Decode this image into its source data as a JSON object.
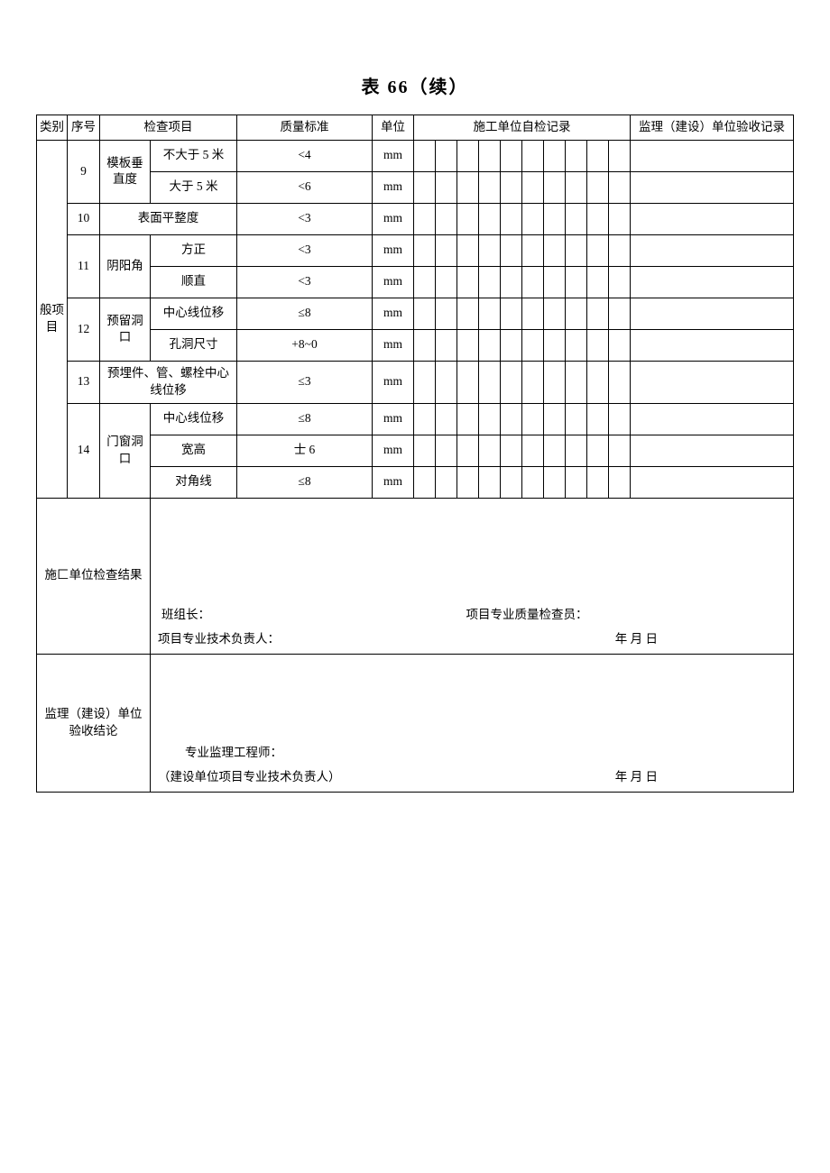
{
  "title": "表 66（续）",
  "headers": {
    "category": "类别",
    "seq": "序号",
    "check_item": "检查项目",
    "quality_std": "质量标准",
    "unit": "单位",
    "self_check": "施工单位自检记录",
    "supervise": "监理（建设）单位验收记录"
  },
  "category_label": "般项目",
  "rows": [
    {
      "seq": "9",
      "group": "模板垂直度",
      "sub": "不大于 5 米",
      "std": "<4",
      "unit": "mm"
    },
    {
      "seq": "",
      "group": "",
      "sub": "大于 5 米",
      "std": "<6",
      "unit": "mm"
    },
    {
      "seq": "10",
      "group": "表面平整度",
      "sub": "",
      "std": "<3",
      "unit": "mm"
    },
    {
      "seq": "11",
      "group": "阴阳角",
      "sub": "方正",
      "std": "<3",
      "unit": "mm"
    },
    {
      "seq": "",
      "group": "",
      "sub": "顺直",
      "std": "<3",
      "unit": "mm"
    },
    {
      "seq": "12",
      "group": "预留洞口",
      "sub": "中心线位移",
      "std": "≤8",
      "unit": "mm"
    },
    {
      "seq": "",
      "group": "",
      "sub": "孔洞尺寸",
      "std": "+8~0",
      "unit": "mm"
    },
    {
      "seq": "13",
      "group": "预埋件、管、螺栓中心线位移",
      "sub": "",
      "std": "≤3",
      "unit": "mm"
    },
    {
      "seq": "14",
      "group": "门窗洞口",
      "sub": "中心线位移",
      "std": "≤8",
      "unit": "mm"
    },
    {
      "seq": "",
      "group": "",
      "sub": "宽高",
      "std": "士 6",
      "unit": "mm"
    },
    {
      "seq": "",
      "group": "",
      "sub": "对角线",
      "std": "≤8",
      "unit": "mm"
    }
  ],
  "sign": {
    "construct_result_label": "施匚单位检查结果",
    "team_leader": "班组长：",
    "quality_inspector": "项目专业质量检查员：",
    "tech_leader": "项目专业技术负责人：",
    "date": "年 月 日",
    "supervise_conclusion_label": "监理（建设）单位验收结论",
    "supervise_engineer": "专业监理工程师：",
    "construct_tech_leader": "（建设单位项目专业技术负责人）"
  }
}
